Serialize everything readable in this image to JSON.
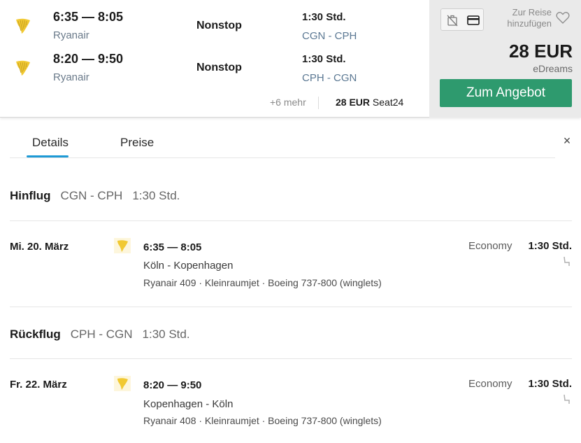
{
  "result": {
    "legs": [
      {
        "times": "6:35 — 8:05",
        "airline": "Ryanair",
        "stops": "Nonstop",
        "duration": "1:30 Std.",
        "route": "CGN - CPH",
        "logo_icon": "ryanair-harp-icon"
      },
      {
        "times": "8:20 — 9:50",
        "airline": "Ryanair",
        "stops": "Nonstop",
        "duration": "1:30 Std.",
        "route": "CPH - CGN",
        "logo_icon": "ryanair-harp-icon"
      }
    ],
    "more_label": "+6 mehr",
    "alt_price": "28 EUR",
    "alt_provider": "Seat24"
  },
  "price_panel": {
    "save_label_line1": "Zur Reise",
    "save_label_line2": "hinzufügen",
    "price": "28 EUR",
    "provider": "eDreams",
    "cta": "Zum Angebot",
    "icons": [
      "no-bag-icon",
      "credit-card-icon",
      "heart-icon"
    ]
  },
  "tabs": [
    {
      "label": "Details",
      "active": true
    },
    {
      "label": "Preise",
      "active": false
    }
  ],
  "close_label": "×",
  "outbound": {
    "title": "Hinflug",
    "route": "CGN - CPH",
    "duration": "1:30 Std.",
    "segment": {
      "date": "Mi. 20. März",
      "times": "6:35 — 8:05",
      "cities": "Köln - Kopenhagen",
      "info": "Ryanair 409 · Kleinraumjet · Boeing 737-800 (winglets)",
      "cabin": "Economy",
      "duration": "1:30 Std."
    }
  },
  "inbound": {
    "title": "Rückflug",
    "route": "CPH - CGN",
    "duration": "1:30 Std.",
    "segment": {
      "date": "Fr. 22. März",
      "times": "8:20 — 9:50",
      "cities": "Kopenhagen - Köln",
      "info": "Ryanair 408 · Kleinraumjet · Boeing 737-800 (winglets)",
      "cabin": "Economy",
      "duration": "1:30 Std."
    }
  },
  "colors": {
    "accent_green": "#2e9a6e",
    "tab_underline": "#1e9ad6",
    "ryanair_yellow": "#f1c933"
  }
}
